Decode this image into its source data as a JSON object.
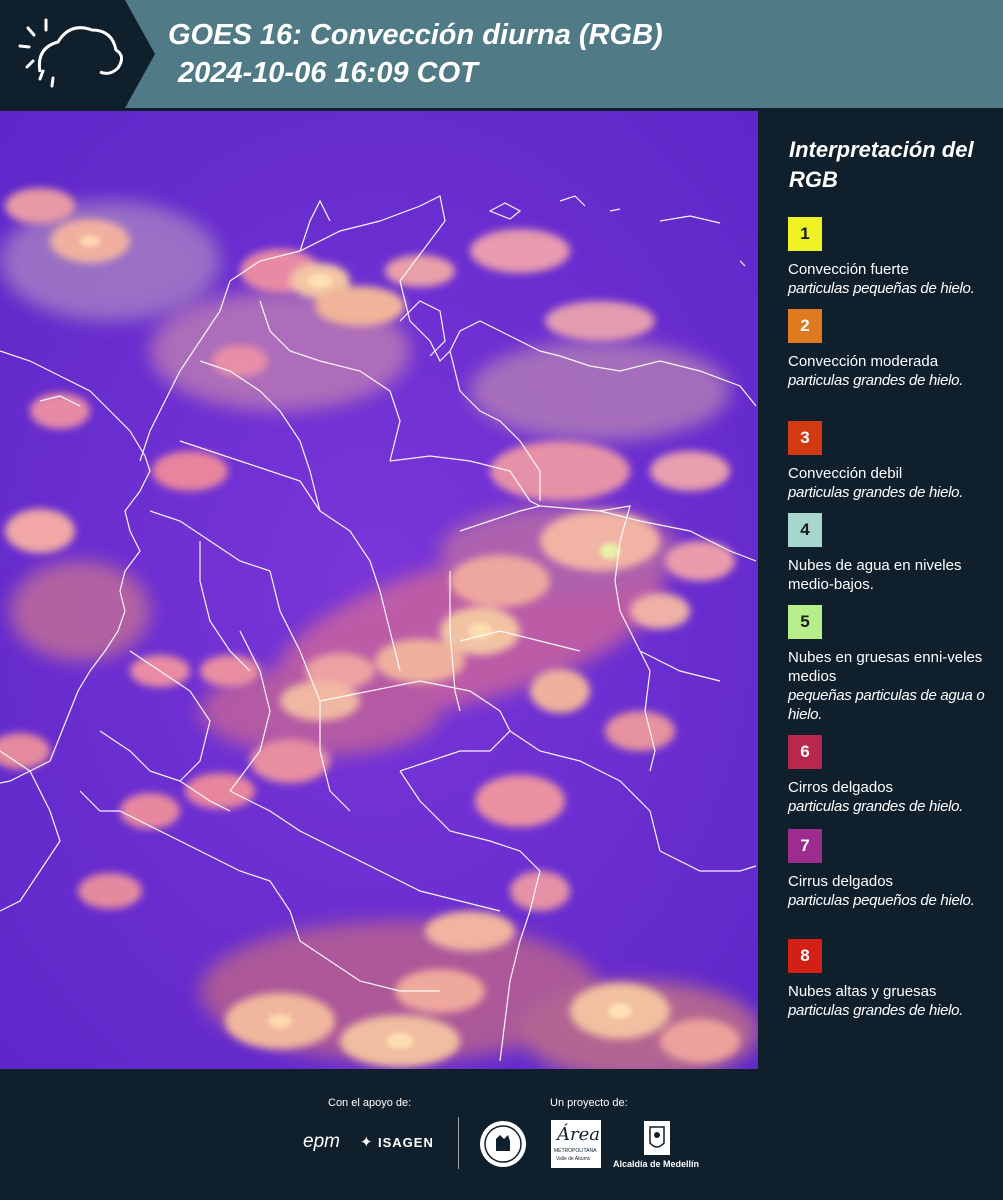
{
  "header": {
    "logo": "SIATA",
    "title_line1": "GOES 16: Convección diurna (RGB)",
    "title_line2": "2024-10-06 16:09 COT"
  },
  "map": {
    "description_icon": "satellite-rgb-map"
  },
  "legend": {
    "title": "Interpretación del RGB",
    "items": [
      {
        "num": "1",
        "color": "#eef224",
        "label": "Convección fuerte",
        "sub": "particulas pequeñas de hielo."
      },
      {
        "num": "2",
        "color": "#e07a20",
        "label": "Convección moderada",
        "sub": "particulas grandes de hielo."
      },
      {
        "num": "3",
        "color": "#d23a14",
        "label": "Convección debil",
        "sub": "particulas grandes de hielo."
      },
      {
        "num": "4",
        "color": "#a8d6cf",
        "label": "Nubes de agua en niveles medio-bajos.",
        "sub": ""
      },
      {
        "num": "5",
        "color": "#b6ef8a",
        "label": "Nubes en gruesas enni-veles medios",
        "sub": "pequeñas particulas de agua o hielo."
      },
      {
        "num": "6",
        "color": "#b8274e",
        "label": "Cirros delgados",
        "sub": "particulas grandes de hielo."
      },
      {
        "num": "7",
        "color": "#9c2d8e",
        "label": "Cirrus delgados",
        "sub": "particulas pequeños de hielo."
      },
      {
        "num": "8",
        "color": "#d41f16",
        "label": "Nubes altas y gruesas",
        "sub": "particulas grandes de hielo."
      }
    ]
  },
  "footer": {
    "support_label": "Con el apoyo de:",
    "project_label": "Un proyecto de:",
    "epm": "epm",
    "isagen": "ISAGEN",
    "area_name": "Área",
    "area_sub": "METROPOLITANA",
    "area_sub2": "Valle de Aburrá",
    "alcaldia": "Alcaldía de Medellín"
  }
}
